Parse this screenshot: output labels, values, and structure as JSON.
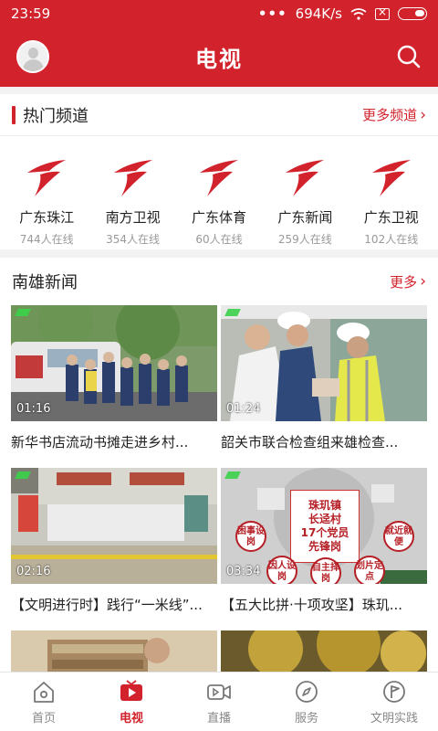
{
  "status": {
    "time": "23:59",
    "speed": "694K/s",
    "dots": "•••"
  },
  "header": {
    "title": "电视"
  },
  "hot": {
    "title": "热门频道",
    "more": "更多频道",
    "channels": [
      {
        "name": "广东珠江",
        "count": "744人在线"
      },
      {
        "name": "南方卫视",
        "count": "354人在线"
      },
      {
        "name": "广东体育",
        "count": "60人在线"
      },
      {
        "name": "广东新闻",
        "count": "259人在线"
      },
      {
        "name": "广东卫视",
        "count": "102人在线"
      }
    ]
  },
  "news": {
    "title": "南雄新闻",
    "more": "更多",
    "items": [
      {
        "title": "新华书店流动书摊走进乡村...",
        "duration": "01:16"
      },
      {
        "title": "韶关市联合检查组来雄检查...",
        "duration": "01:24"
      },
      {
        "title": "【文明进行时】践行“一米线”...",
        "duration": "02:16"
      },
      {
        "title": "【五大比拼·十项攻坚】珠玑...",
        "duration": "03:34"
      }
    ]
  },
  "thumb_text": {
    "poster_main": [
      "珠玑镇",
      "长迳村",
      "17个党员",
      "先锋岗"
    ],
    "bubbles": [
      "困事设岗",
      "就近就便",
      "因人设岗",
      "自主择岗",
      "划片定点"
    ]
  },
  "tabs": [
    {
      "label": "首页",
      "icon": "home-icon"
    },
    {
      "label": "电视",
      "icon": "tv-icon"
    },
    {
      "label": "直播",
      "icon": "live-camera-icon"
    },
    {
      "label": "服务",
      "icon": "compass-icon"
    },
    {
      "label": "文明实践",
      "icon": "flag-icon"
    }
  ],
  "colors": {
    "brand": "#d2222c",
    "text": "#222222",
    "muted": "#999999"
  }
}
